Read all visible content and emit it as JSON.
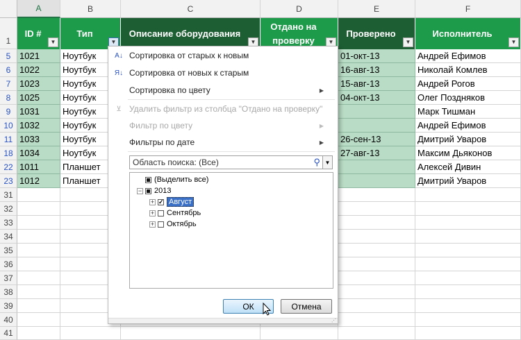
{
  "columns": {
    "letters": [
      "A",
      "B",
      "C",
      "D",
      "E",
      "F"
    ],
    "headers": [
      "ID #",
      "Тип",
      "Описание оборудования",
      "Отдано на проверку",
      "Проверено",
      "Исполнитель"
    ]
  },
  "rows": [
    {
      "num": "1",
      "cells": [
        "",
        "",
        "",
        "",
        "",
        ""
      ]
    },
    {
      "num": "5",
      "cells": [
        "1021",
        "Ноутбук",
        "",
        "",
        "01-окт-13",
        "Андрей Ефимов"
      ]
    },
    {
      "num": "6",
      "cells": [
        "1022",
        "Ноутбук",
        "",
        "",
        "16-авг-13",
        "Николай Комлев"
      ]
    },
    {
      "num": "7",
      "cells": [
        "1023",
        "Ноутбук",
        "",
        "",
        "15-авг-13",
        "Андрей Рогов"
      ]
    },
    {
      "num": "8",
      "cells": [
        "1025",
        "Ноутбук",
        "",
        "",
        "04-окт-13",
        "Олег Поздняков"
      ]
    },
    {
      "num": "9",
      "cells": [
        "1031",
        "Ноутбук",
        "",
        "",
        "",
        "Марк Тишман"
      ]
    },
    {
      "num": "10",
      "cells": [
        "1032",
        "Ноутбук",
        "",
        "",
        "",
        "Андрей Ефимов"
      ]
    },
    {
      "num": "11",
      "cells": [
        "1033",
        "Ноутбук",
        "",
        "",
        "26-сен-13",
        "Дмитрий Уваров"
      ]
    },
    {
      "num": "18",
      "cells": [
        "1034",
        "Ноутбук",
        "",
        "",
        "27-авг-13",
        "Максим Дьяконов"
      ]
    },
    {
      "num": "22",
      "cells": [
        "1011",
        "Планшет",
        "",
        "",
        "",
        "Алексей Дивин"
      ]
    },
    {
      "num": "23",
      "cells": [
        "1012",
        "Планшет",
        "",
        "",
        "",
        "Дмитрий Уваров"
      ]
    },
    {
      "num": "31",
      "cells": [
        "",
        "",
        "",
        "",
        "",
        ""
      ]
    },
    {
      "num": "32",
      "cells": [
        "",
        "",
        "",
        "",
        "",
        ""
      ]
    },
    {
      "num": "33",
      "cells": [
        "",
        "",
        "",
        "",
        "",
        ""
      ]
    },
    {
      "num": "34",
      "cells": [
        "",
        "",
        "",
        "",
        "",
        ""
      ]
    },
    {
      "num": "35",
      "cells": [
        "",
        "",
        "",
        "",
        "",
        ""
      ]
    },
    {
      "num": "36",
      "cells": [
        "",
        "",
        "",
        "",
        "",
        ""
      ]
    },
    {
      "num": "37",
      "cells": [
        "",
        "",
        "",
        "",
        "",
        ""
      ]
    },
    {
      "num": "38",
      "cells": [
        "",
        "",
        "",
        "",
        "",
        ""
      ]
    },
    {
      "num": "39",
      "cells": [
        "",
        "",
        "",
        "",
        "",
        ""
      ]
    },
    {
      "num": "40",
      "cells": [
        "",
        "",
        "",
        "",
        "",
        ""
      ]
    },
    {
      "num": "41",
      "cells": [
        "",
        "",
        "",
        "",
        "",
        ""
      ]
    }
  ],
  "menu": {
    "sort_asc": "Сортировка от старых к новым",
    "sort_desc": "Сортировка от новых к старым",
    "sort_color": "Сортировка по цвету",
    "clear_filter": "Удалить фильтр из столбца \"Отдано на проверку\"",
    "filter_color": "Фильтр по цвету",
    "date_filters": "Фильтры по дате",
    "search_placeholder": "Область поиска: (Все)",
    "tree": {
      "select_all": "(Выделить все)",
      "year": "2013",
      "months": [
        "Август",
        "Сентябрь",
        "Октябрь"
      ]
    },
    "ok": "ОК",
    "cancel": "Отмена"
  },
  "colors": {
    "header_green": "#1e9b4a",
    "header_dark": "#1d5e33",
    "cell_green": "#b8dcc5"
  },
  "icons": [
    "sort-asc-icon",
    "sort-desc-icon",
    "clear-filter-icon",
    "search-icon",
    "dropdown-icon",
    "filter-icon",
    "mouse-cursor-icon"
  ]
}
